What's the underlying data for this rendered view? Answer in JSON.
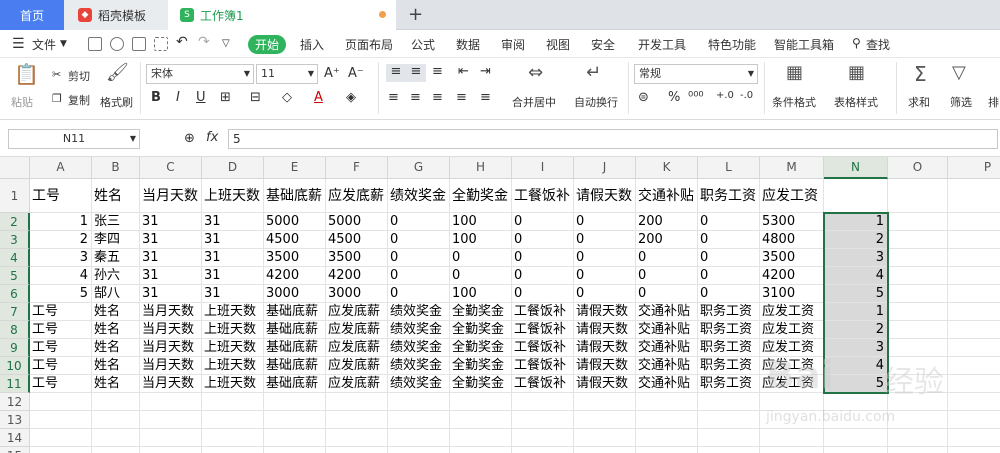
{
  "tabs": {
    "home": "首页",
    "template": "稻壳模板",
    "workbook": "工作簿1",
    "add": "+"
  },
  "menu": {
    "file": "文件",
    "start": "开始",
    "items": [
      "插入",
      "页面布局",
      "公式",
      "数据",
      "审阅",
      "视图",
      "安全",
      "开发工具",
      "特色功能",
      "智能工具箱"
    ],
    "search": "查找"
  },
  "ribbon": {
    "paste": "粘贴",
    "cut": "剪切",
    "copy": "复制",
    "format_painter": "格式刷",
    "font_name": "宋体",
    "font_size": "11",
    "merge_center": "合并居中",
    "wrap_text": "自动换行",
    "number_format": "常规",
    "conditional_format": "条件格式",
    "table_style": "表格样式",
    "sum": "求和",
    "filter": "筛选",
    "sort": "排"
  },
  "formula_bar": {
    "name_box": "N11",
    "fx": "fx",
    "value": "5"
  },
  "columns": [
    "A",
    "B",
    "C",
    "D",
    "E",
    "F",
    "G",
    "H",
    "I",
    "J",
    "K",
    "L",
    "M",
    "N",
    "O",
    "P"
  ],
  "rows": [
    "1",
    "2",
    "3",
    "4",
    "5",
    "6",
    "7",
    "8",
    "9",
    "10",
    "11",
    "12",
    "13",
    "14",
    "15"
  ],
  "cells": [
    [
      "工号",
      "姓名",
      "当月天数",
      "上班天数",
      "基础底薪",
      "应发底薪",
      "绩效奖金",
      "全勤奖金",
      "工餐饭补",
      "请假天数",
      "交通补贴",
      "职务工资",
      "应发工资",
      ""
    ],
    [
      "1",
      "张三",
      "31",
      "31",
      "5000",
      "5000",
      "0",
      "100",
      "0",
      "0",
      "200",
      "0",
      "5300",
      "1"
    ],
    [
      "2",
      "李四",
      "31",
      "31",
      "4500",
      "4500",
      "0",
      "100",
      "0",
      "0",
      "200",
      "0",
      "4800",
      "2"
    ],
    [
      "3",
      "秦五",
      "31",
      "31",
      "3500",
      "3500",
      "0",
      "0",
      "0",
      "0",
      "0",
      "0",
      "3500",
      "3"
    ],
    [
      "4",
      "孙六",
      "31",
      "31",
      "4200",
      "4200",
      "0",
      "0",
      "0",
      "0",
      "0",
      "0",
      "4200",
      "4"
    ],
    [
      "5",
      "郜八",
      "31",
      "31",
      "3000",
      "3000",
      "0",
      "100",
      "0",
      "0",
      "0",
      "0",
      "3100",
      "5"
    ],
    [
      "工号",
      "姓名",
      "当月天数",
      "上班天数",
      "基础底薪",
      "应发底薪",
      "绩效奖金",
      "全勤奖金",
      "工餐饭补",
      "请假天数",
      "交通补贴",
      "职务工资",
      "应发工资",
      "1"
    ],
    [
      "工号",
      "姓名",
      "当月天数",
      "上班天数",
      "基础底薪",
      "应发底薪",
      "绩效奖金",
      "全勤奖金",
      "工餐饭补",
      "请假天数",
      "交通补贴",
      "职务工资",
      "应发工资",
      "2"
    ],
    [
      "工号",
      "姓名",
      "当月天数",
      "上班天数",
      "基础底薪",
      "应发底薪",
      "绩效奖金",
      "全勤奖金",
      "工餐饭补",
      "请假天数",
      "交通补贴",
      "职务工资",
      "应发工资",
      "3"
    ],
    [
      "工号",
      "姓名",
      "当月天数",
      "上班天数",
      "基础底薪",
      "应发底薪",
      "绩效奖金",
      "全勤奖金",
      "工餐饭补",
      "请假天数",
      "交通补贴",
      "职务工资",
      "应发工资",
      "4"
    ],
    [
      "工号",
      "姓名",
      "当月天数",
      "上班天数",
      "基础底薪",
      "应发底薪",
      "绩效奖金",
      "全勤奖金",
      "工餐饭补",
      "请假天数",
      "交通补贴",
      "职务工资",
      "应发工资",
      "5"
    ]
  ],
  "watermark": {
    "brand": "Bai",
    "text": "经验",
    "url": "jingyan.baidu.com"
  },
  "colors": {
    "accent": "#2fb35c",
    "selection": "#217346",
    "home_tab": "#4a7ef0"
  }
}
